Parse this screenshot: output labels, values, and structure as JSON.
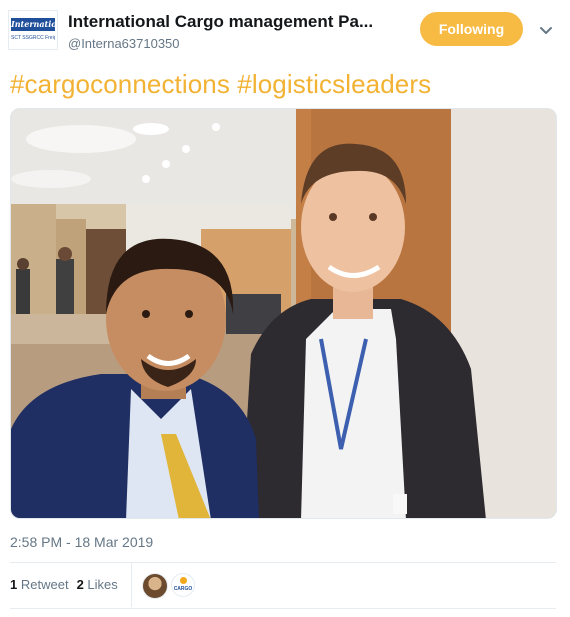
{
  "author": {
    "name": "International Cargo management Pa...",
    "handle": "@Interna63710350",
    "avatar_logo_text": "International C",
    "avatar_logo_sub": "SCT SSGRCC Freight"
  },
  "follow_button": {
    "label": "Following",
    "color": "#f7bb43"
  },
  "tweet": {
    "hashtags": [
      "#cargoconnections",
      "#logisticsleaders"
    ],
    "hashtag_color": "#f2b233",
    "timestamp": "2:58 PM - 18 Mar 2019"
  },
  "stats": {
    "retweets_count": "1",
    "retweets_label": "Retweet",
    "likes_count": "2",
    "likes_label": "Likes"
  },
  "likers": [
    {
      "kind": "person-photo"
    },
    {
      "kind": "logo",
      "text": "CARGO"
    }
  ],
  "icons": {
    "menu": "chevron-down-icon"
  }
}
